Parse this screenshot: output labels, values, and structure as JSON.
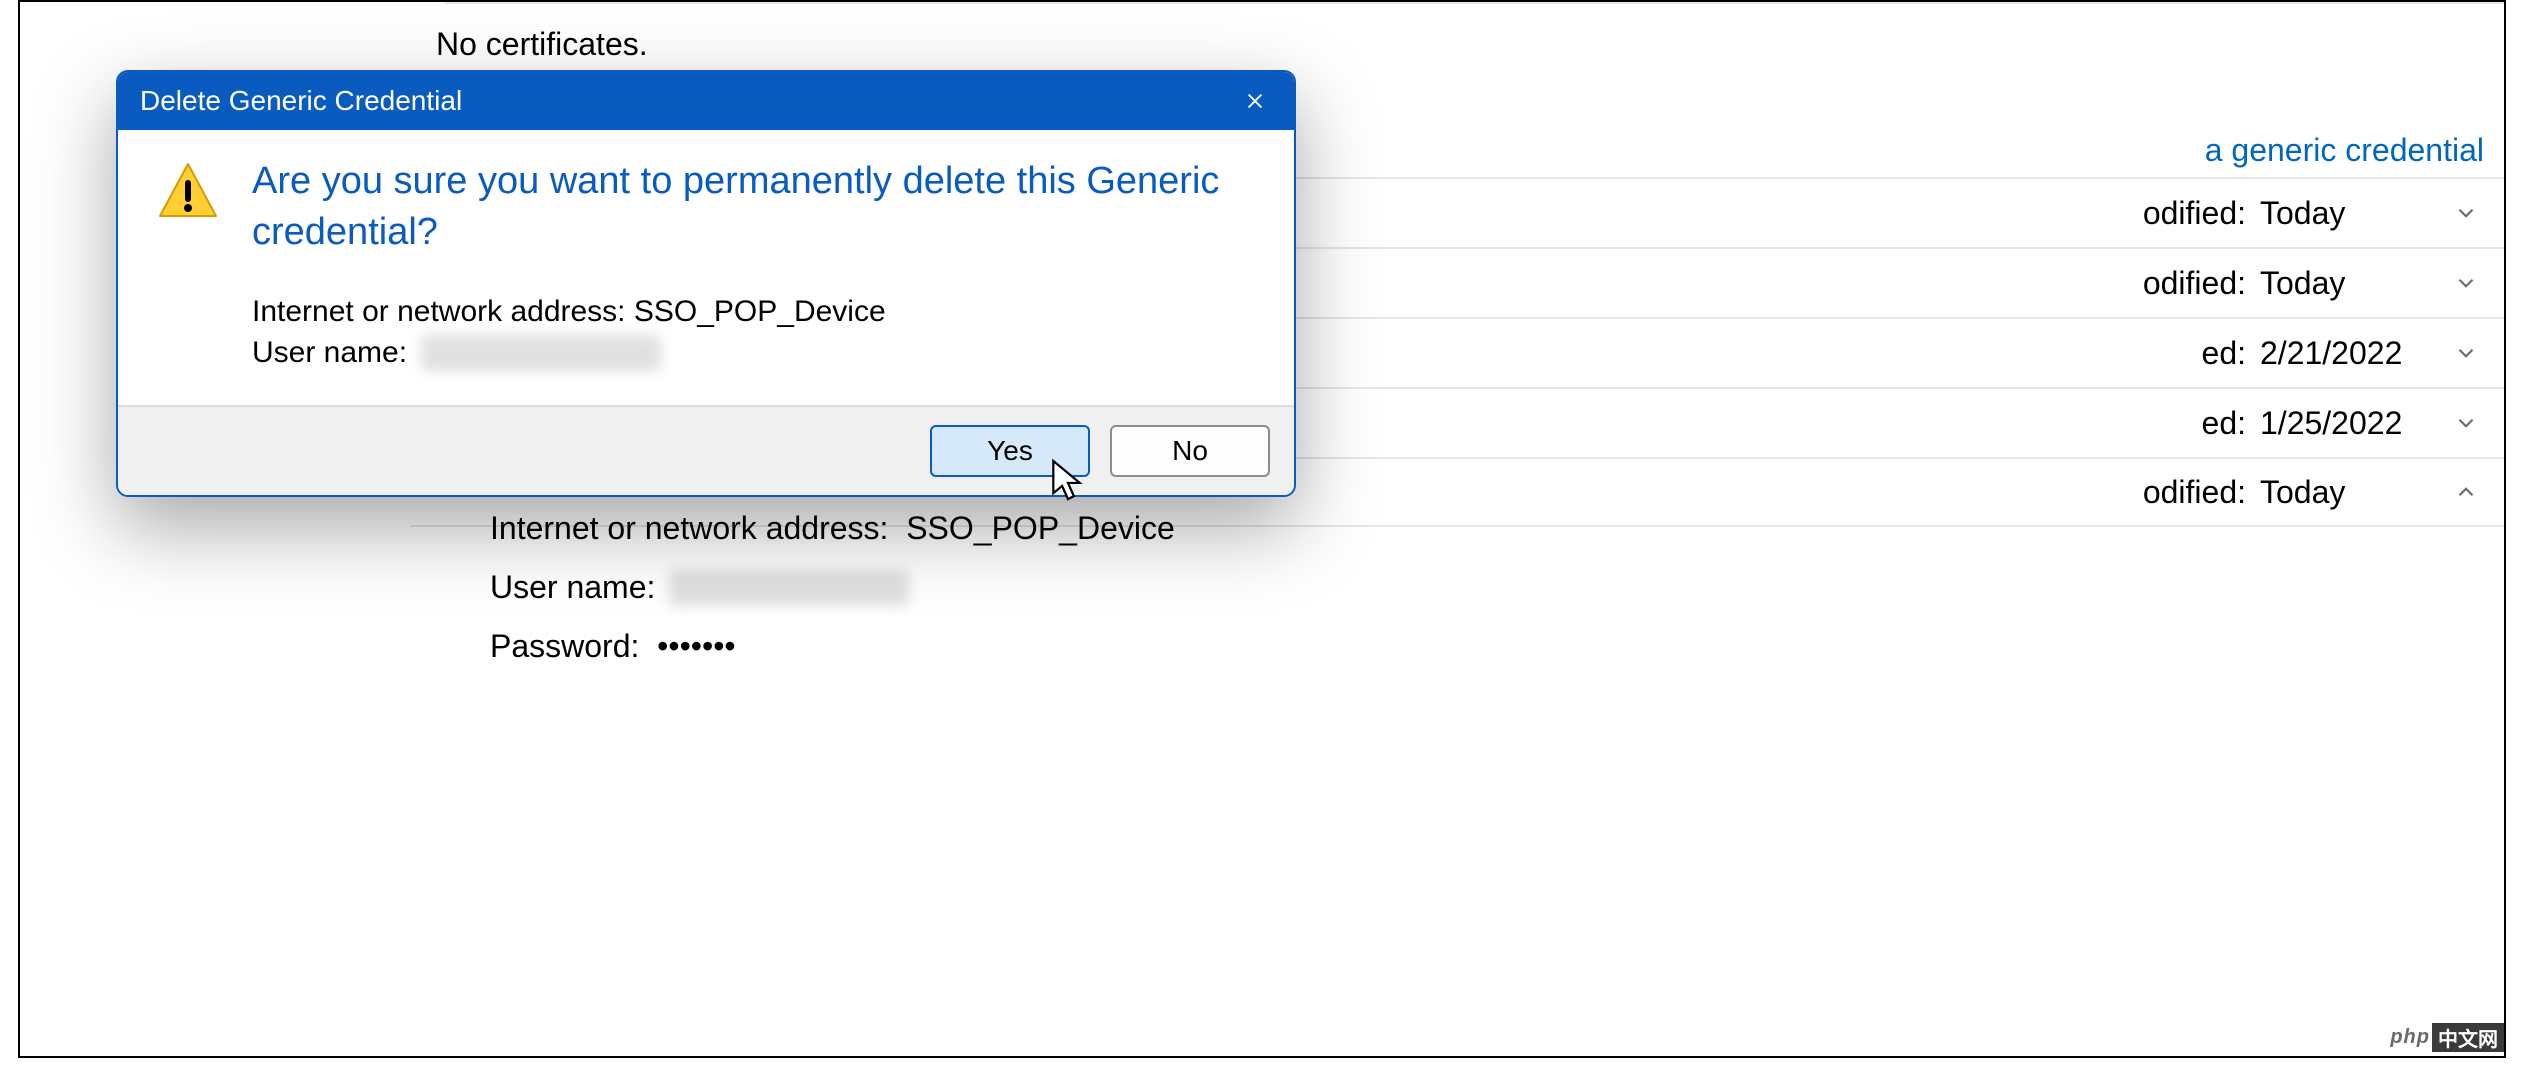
{
  "background": {
    "no_certs": "No certificates.",
    "generic_link": "a generic credential",
    "rows": [
      {
        "label": "odified:",
        "value": "Today",
        "expanded": false
      },
      {
        "label": "odified:",
        "value": "Today",
        "expanded": false
      },
      {
        "label": "ed:",
        "value": "2/21/2022",
        "expanded": false
      },
      {
        "label": "ed:",
        "value": "1/25/2022",
        "expanded": false
      },
      {
        "label": "odified:",
        "value": "Today",
        "expanded": true
      }
    ],
    "detail": {
      "address_label": "Internet or network address:",
      "address_value": "SSO_POP_Device",
      "username_label": "User name:",
      "password_label": "Password:",
      "password_value": "•••••••"
    }
  },
  "dialog": {
    "title": "Delete Generic Credential",
    "instruction": "Are you sure you want to permanently delete this Generic credential?",
    "address_label": "Internet or network address:",
    "address_value": "SSO_POP_Device",
    "username_label": "User name:",
    "buttons": {
      "yes": "Yes",
      "no": "No"
    }
  },
  "watermark": {
    "a": "php",
    "b": "中文网"
  }
}
